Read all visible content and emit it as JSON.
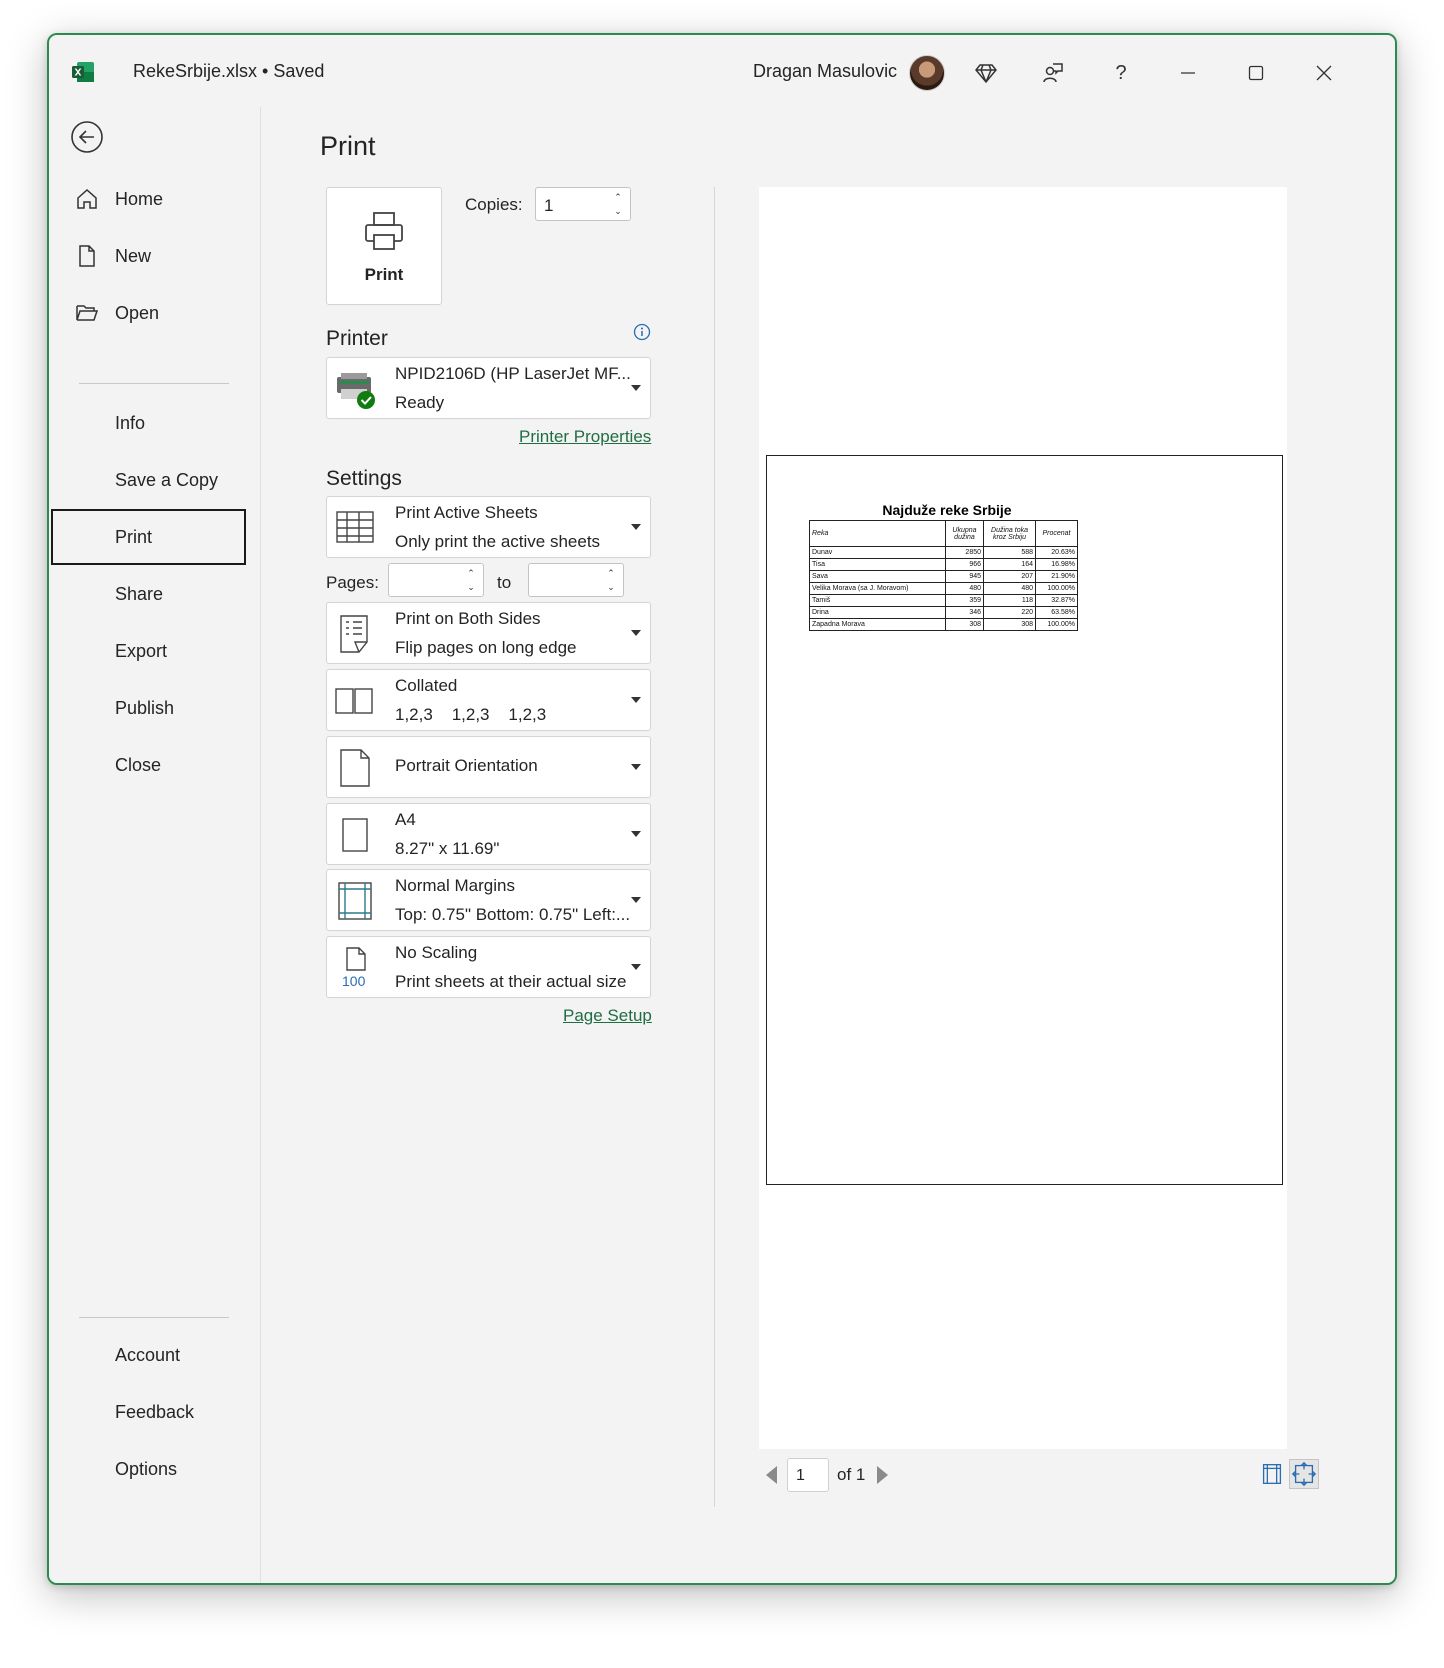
{
  "titlebar": {
    "doc_title": "RekeSrbije.xlsx • Saved",
    "user_name": "Dragan Masulovic",
    "help": "?"
  },
  "nav": {
    "top": [
      {
        "label": "Home",
        "icon": "home-icon"
      },
      {
        "label": "New",
        "icon": "new-document-icon"
      },
      {
        "label": "Open",
        "icon": "folder-open-icon"
      }
    ],
    "middle": [
      "Info",
      "Save a Copy",
      "Print",
      "Share",
      "Export",
      "Publish",
      "Close"
    ],
    "selected": "Print",
    "bottom": [
      "Account",
      "Feedback",
      "Options"
    ]
  },
  "print": {
    "heading": "Print",
    "print_button": "Print",
    "copies_label": "Copies:",
    "copies_value": "1",
    "printer_heading": "Printer",
    "printer_name": "NPID2106D (HP LaserJet MF...",
    "printer_status": "Ready",
    "printer_properties": "Printer Properties",
    "settings_heading": "Settings",
    "pages_label": "Pages:",
    "to_label": "to",
    "pages_from": "",
    "pages_to": "",
    "settings": [
      {
        "l1": "Print Active Sheets",
        "l2": "Only print the active sheets"
      },
      {
        "l1": "Print on Both Sides",
        "l2": "Flip pages on long edge"
      },
      {
        "l1": "Collated",
        "l2": "1,2,3    1,2,3    1,2,3"
      },
      {
        "l1": "Portrait Orientation",
        "l2": ""
      },
      {
        "l1": "A4",
        "l2": "8.27\" x 11.69\""
      },
      {
        "l1": "Normal Margins",
        "l2": "Top: 0.75\" Bottom: 0.75\" Left:..."
      },
      {
        "l1": "No Scaling",
        "l2": "Print sheets at their actual size"
      }
    ],
    "page_setup": "Page Setup",
    "scaling_icon_text": "100"
  },
  "preview": {
    "title": "Najduže reke Srbije",
    "headers": [
      "Reka",
      "Ukupna dužina",
      "Dužina toka kroz Srbiju",
      "Procenat"
    ],
    "rows": [
      [
        "Dunav",
        "2850",
        "588",
        "20.63%"
      ],
      [
        "Tisa",
        "966",
        "164",
        "16.98%"
      ],
      [
        "Sava",
        "945",
        "207",
        "21.90%"
      ],
      [
        "Velika Morava (sa J. Moravom)",
        "480",
        "480",
        "100.00%"
      ],
      [
        "Tamiš",
        "359",
        "118",
        "32.87%"
      ],
      [
        "Drina",
        "346",
        "220",
        "63.58%"
      ],
      [
        "Zapadna Morava",
        "308",
        "308",
        "100.00%"
      ]
    ]
  },
  "pager": {
    "current_page": "1",
    "of_label": "of 1"
  },
  "annotation": {
    "color": "#d42020",
    "marker": "1"
  },
  "colors": {
    "accent": "#2d8a4e",
    "link": "#1f6e43"
  }
}
